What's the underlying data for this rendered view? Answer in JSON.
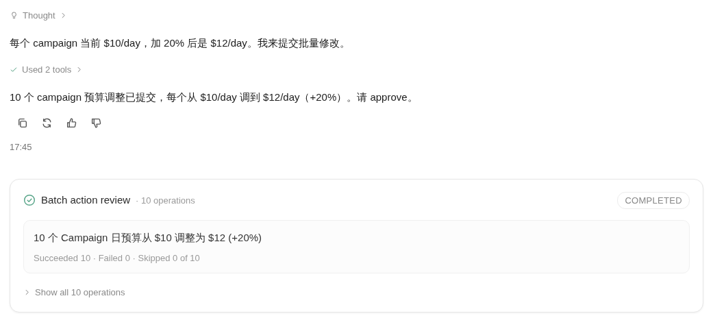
{
  "entries": [
    {
      "kind": "thought",
      "label": "Thought",
      "expanded": false
    },
    {
      "kind": "text",
      "text": "每个 campaign 当前 $10/day，加 20% 后是 $12/day。我来提交批量修改。"
    },
    {
      "kind": "tools",
      "label": "Used 2 tools",
      "expanded": false
    },
    {
      "kind": "text",
      "text": "10 个 campaign 预算调整已提交，每个从 $10/day 调到 $12/day（+20%）。请 approve。"
    }
  ],
  "time": "17:45",
  "review": {
    "title": "Batch action review",
    "count": "· 10 operations",
    "status": "COMPLETED",
    "summary": {
      "title": "10 个 Campaign 日预算从 $10 调整为 $12 (+20%)",
      "stats": "Succeeded 10 · Failed 0 · Skipped 0 of 10"
    },
    "toggle": {
      "label": "Show all 10 operations",
      "expanded": false
    }
  }
}
